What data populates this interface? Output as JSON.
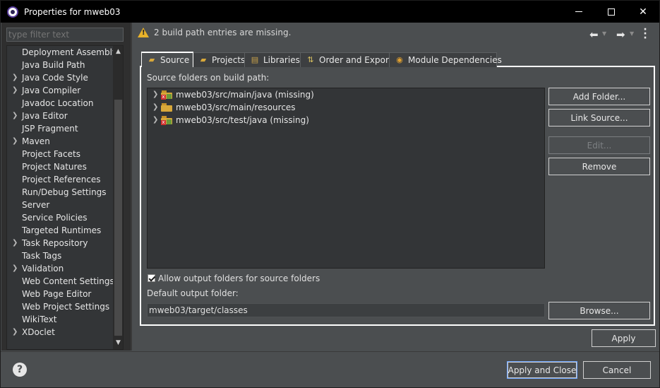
{
  "window": {
    "title": "Properties for mweb03",
    "minimize": "—",
    "maximize": "□",
    "close": "✕"
  },
  "filter": {
    "placeholder": "type filter text"
  },
  "sidebar": {
    "items": [
      {
        "label": "Deployment Assembly",
        "expandable": false
      },
      {
        "label": "Java Build Path",
        "expandable": false,
        "selected": true
      },
      {
        "label": "Java Code Style",
        "expandable": true
      },
      {
        "label": "Java Compiler",
        "expandable": true
      },
      {
        "label": "Javadoc Location",
        "expandable": false
      },
      {
        "label": "Java Editor",
        "expandable": true
      },
      {
        "label": "JSP Fragment",
        "expandable": false
      },
      {
        "label": "Maven",
        "expandable": true
      },
      {
        "label": "Project Facets",
        "expandable": false
      },
      {
        "label": "Project Natures",
        "expandable": false
      },
      {
        "label": "Project References",
        "expandable": false
      },
      {
        "label": "Run/Debug Settings",
        "expandable": false
      },
      {
        "label": "Server",
        "expandable": false
      },
      {
        "label": "Service Policies",
        "expandable": false
      },
      {
        "label": "Targeted Runtimes",
        "expandable": false
      },
      {
        "label": "Task Repository",
        "expandable": true
      },
      {
        "label": "Task Tags",
        "expandable": false
      },
      {
        "label": "Validation",
        "expandable": true
      },
      {
        "label": "Web Content Settings",
        "expandable": false
      },
      {
        "label": "Web Page Editor",
        "expandable": false
      },
      {
        "label": "Web Project Settings",
        "expandable": false
      },
      {
        "label": "WikiText",
        "expandable": false
      },
      {
        "label": "XDoclet",
        "expandable": true
      }
    ]
  },
  "message": {
    "text": "2 build path entries are missing.",
    "icon": "warning-icon"
  },
  "tabs": [
    {
      "label": "Source",
      "icon": "source-folder-icon",
      "active": true
    },
    {
      "label": "Projects",
      "icon": "projects-folder-icon"
    },
    {
      "label": "Libraries",
      "icon": "libraries-icon"
    },
    {
      "label": "Order and Export",
      "icon": "order-export-icon"
    },
    {
      "label": "Module Dependencies",
      "icon": "module-icon"
    }
  ],
  "source": {
    "heading": "Source folders on build path:",
    "folders": [
      {
        "label": "mweb03/src/main/java (missing)",
        "missing": true
      },
      {
        "label": "mweb03/src/main/resources",
        "missing": false
      },
      {
        "label": "mweb03/src/test/java (missing)",
        "missing": true
      }
    ],
    "buttons": {
      "add_folder": "Add Folder...",
      "link_source": "Link Source...",
      "edit": "Edit...",
      "remove": "Remove"
    },
    "allow_output_label": "Allow output folders for source folders",
    "allow_output_checked": true,
    "default_output_label": "Default output folder:",
    "default_output_value": "mweb03/target/classes",
    "browse": "Browse..."
  },
  "footer": {
    "apply": "Apply",
    "apply_close": "Apply and Close",
    "cancel": "Cancel",
    "help": "?"
  },
  "colors": {
    "dialog_bg": "#4b4e50",
    "tree_bg": "#333537",
    "warning": "#e8b22a",
    "focus_border": "#6aa3ff"
  }
}
